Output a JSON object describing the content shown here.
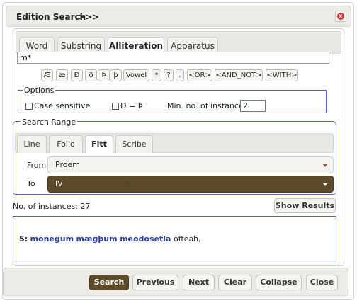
{
  "dialog": {
    "title": "Edition Search",
    "expand_label": ">>>",
    "close_icon": "x"
  },
  "tabs": [
    {
      "label": "Word"
    },
    {
      "label": "Substring"
    },
    {
      "label": "Alliteration"
    },
    {
      "label": "Apparatus"
    }
  ],
  "active_tab": "Alliteration",
  "query": {
    "value": "m*"
  },
  "special_chars": [
    "Æ",
    "æ",
    "Ð",
    "ð",
    "Þ",
    "þ",
    "Vowel",
    "*",
    "?",
    ".",
    "<OR>",
    "<AND_NOT>",
    "<WITH>"
  ],
  "options": {
    "legend": "Options",
    "case_sensitive_label": "Case sensitive",
    "case_sensitive_checked": false,
    "eth_thorn_label": "Ð = Þ",
    "eth_thorn_checked": false,
    "min_instances_label": "Min. no. of instances",
    "min_instances_value": "2"
  },
  "search_range": {
    "legend": "Search Range",
    "tabs": [
      {
        "label": "Line"
      },
      {
        "label": "Folio"
      },
      {
        "label": "Fitt"
      },
      {
        "label": "Scribe"
      }
    ],
    "active_tab": "Fitt",
    "from_label": "From",
    "from_value": "Proem",
    "to_label": "To",
    "to_value": "IV"
  },
  "results": {
    "count_label": "No. of instances: 27",
    "show_results_label": "Show Results",
    "line_number": "5:",
    "hits": [
      "monegum",
      "mægþum",
      "meodosetla"
    ],
    "rest": "ofteah,"
  },
  "footer": {
    "search": "Search",
    "previous": "Previous",
    "next": "Next",
    "clear": "Clear",
    "collapse": "Collapse",
    "close": "Close"
  },
  "colors": {
    "accent": "#5d4a2b",
    "highlight": "#2a3fa8",
    "border_blue": "#5560c4"
  }
}
